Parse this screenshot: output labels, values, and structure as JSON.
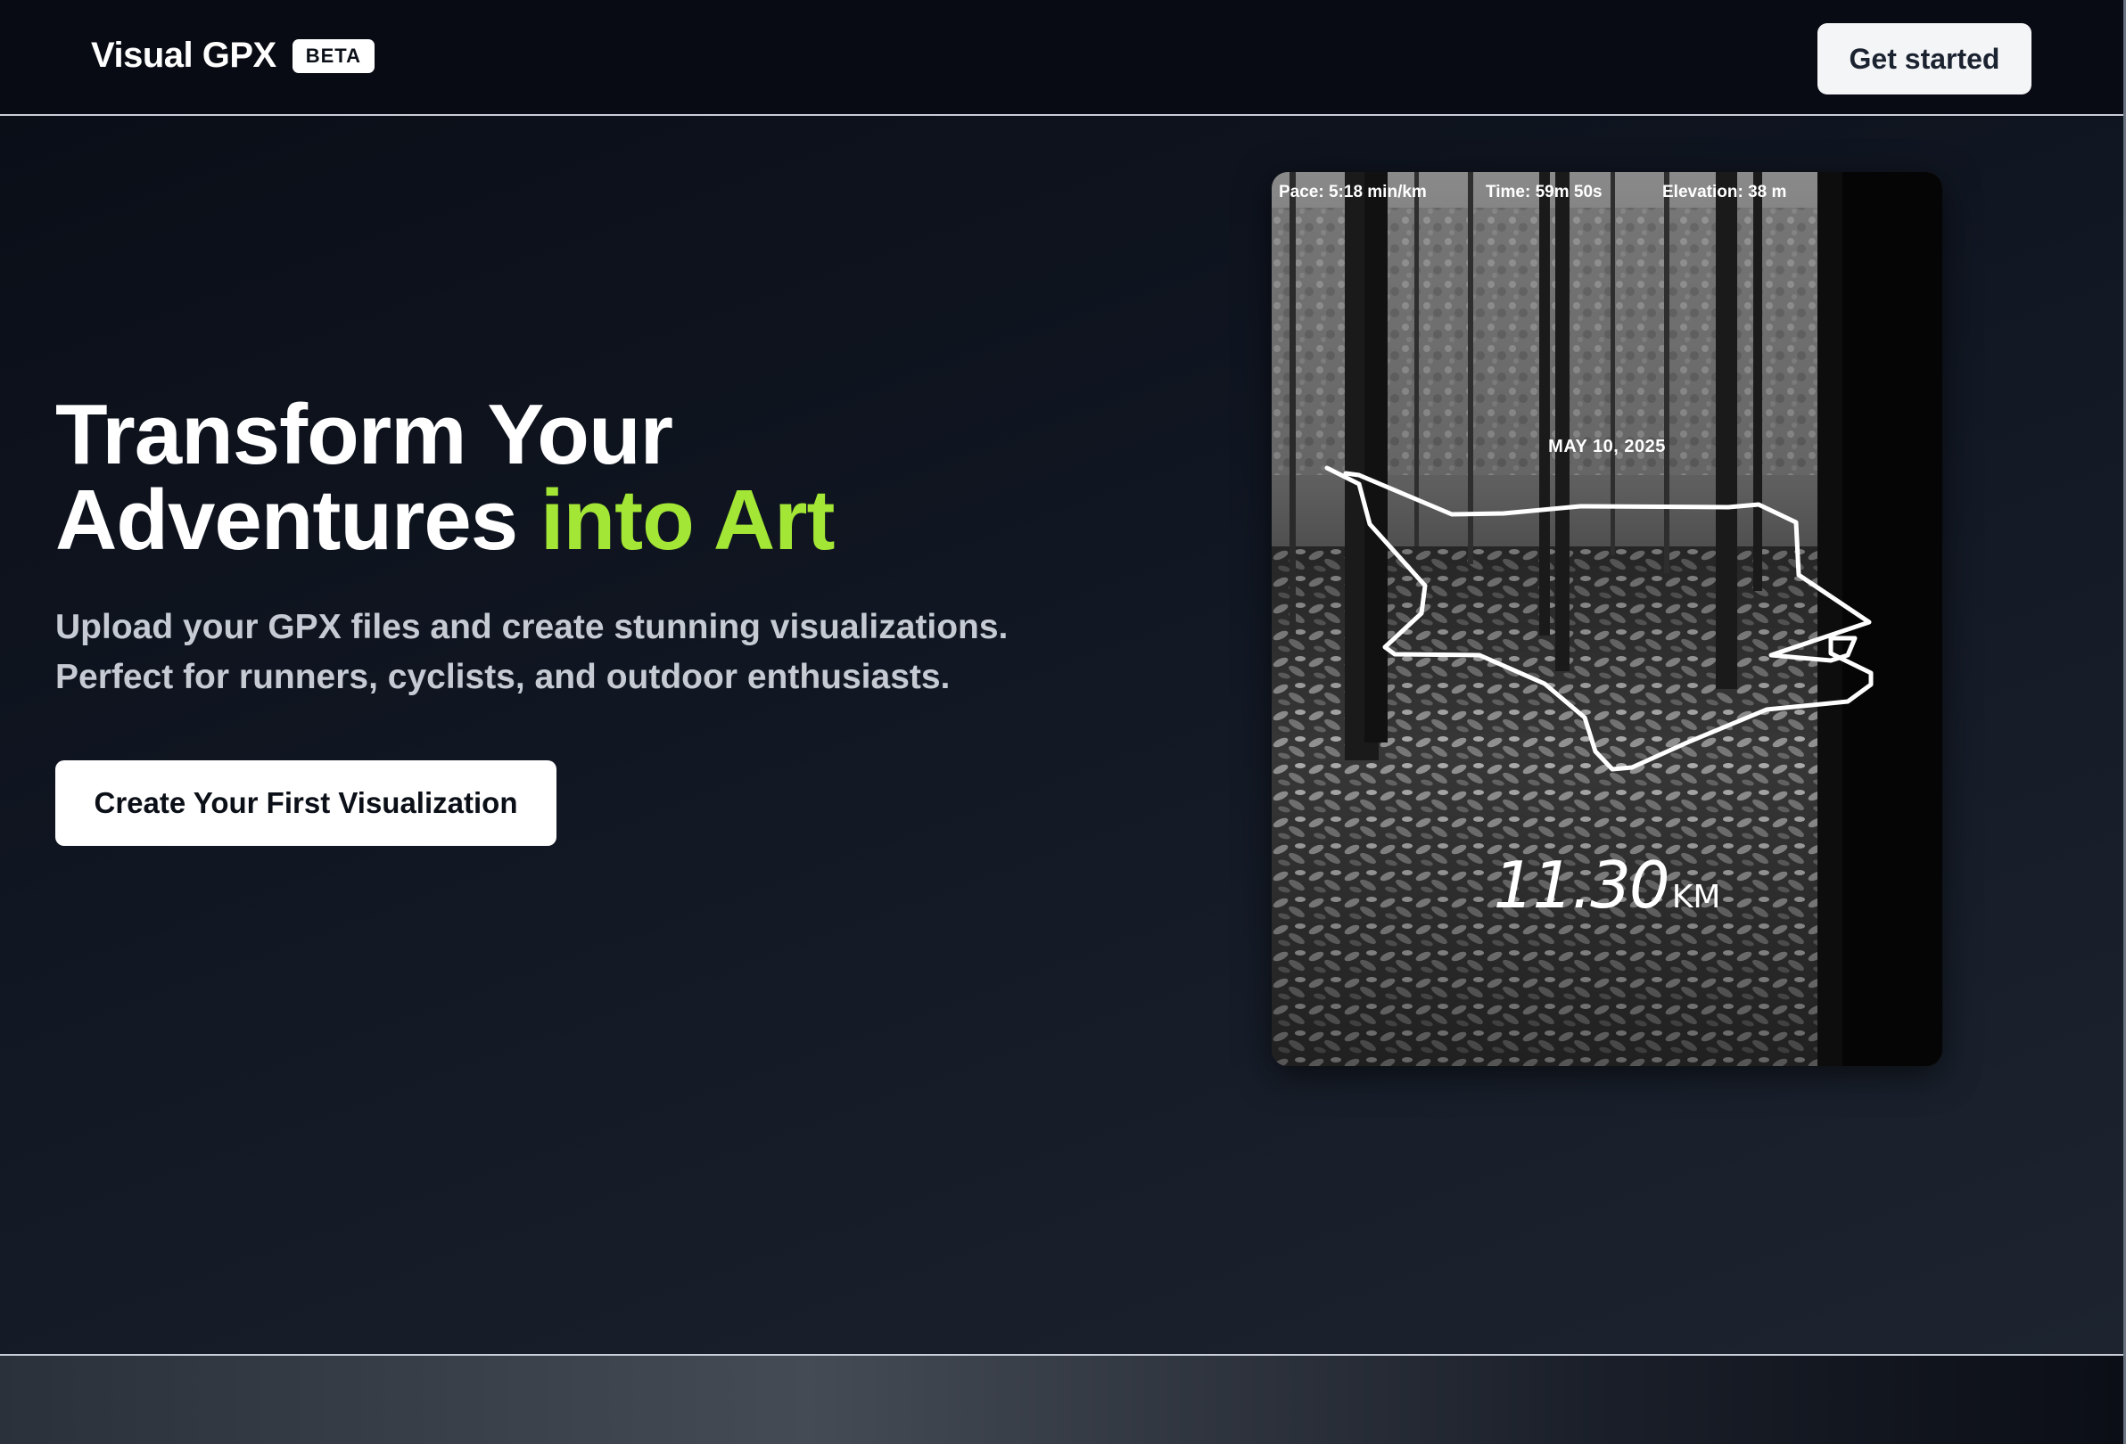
{
  "nav": {
    "brand": "Visual GPX",
    "badge": "BETA",
    "cta_label": "Get started"
  },
  "hero": {
    "headline_line1": "Transform Your",
    "headline_line2_prefix": "Adventures ",
    "headline_line2_accent": "into Art",
    "subtext_line1": "Upload your GPX files and create stunning visualizations.",
    "subtext_line2": "Perfect for runners, cyclists, and outdoor enthusiasts.",
    "cta_label": "Create Your First Visualization"
  },
  "preview": {
    "pace": "Pace: 5:18 min/km",
    "time": "Time: 59m 50s",
    "elevation": "Elevation: 38 m",
    "date": "MAY 10, 2025",
    "distance_value": "11.30",
    "distance_unit": "KM"
  },
  "colors": {
    "accent": "#a3e635",
    "background": "#0b0f17",
    "button_bg": "#ffffff"
  }
}
